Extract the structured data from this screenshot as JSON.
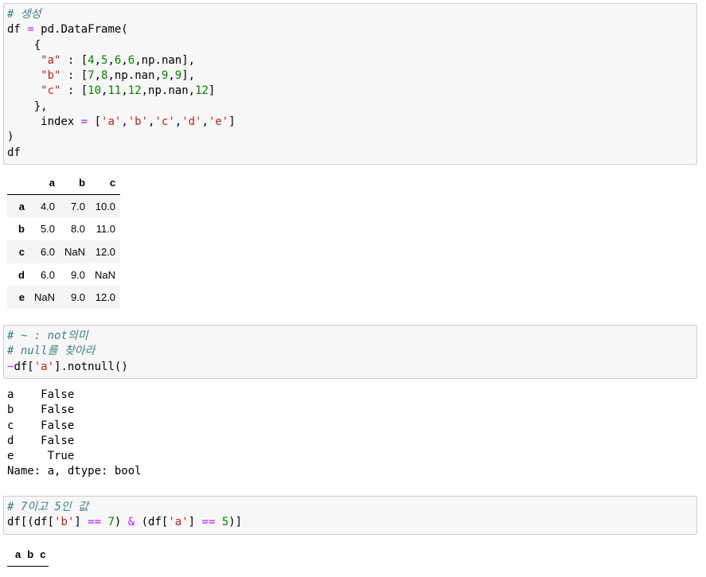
{
  "cell1": {
    "lines": [
      [
        {
          "t": "# 생성",
          "c": "cm"
        }
      ],
      [
        {
          "t": "df ",
          "c": ""
        },
        {
          "t": "=",
          "c": "o"
        },
        {
          "t": " pd.DataFrame(",
          "c": ""
        }
      ],
      [
        {
          "t": "    {",
          "c": ""
        }
      ],
      [
        {
          "t": "     ",
          "c": ""
        },
        {
          "t": "\"a\"",
          "c": "s"
        },
        {
          "t": " : [",
          "c": ""
        },
        {
          "t": "4",
          "c": "n"
        },
        {
          "t": ",",
          "c": ""
        },
        {
          "t": "5",
          "c": "n"
        },
        {
          "t": ",",
          "c": ""
        },
        {
          "t": "6",
          "c": "n"
        },
        {
          "t": ",",
          "c": ""
        },
        {
          "t": "6",
          "c": "n"
        },
        {
          "t": ",np.nan],",
          "c": ""
        }
      ],
      [
        {
          "t": "     ",
          "c": ""
        },
        {
          "t": "\"b\"",
          "c": "s"
        },
        {
          "t": " : [",
          "c": ""
        },
        {
          "t": "7",
          "c": "n"
        },
        {
          "t": ",",
          "c": ""
        },
        {
          "t": "8",
          "c": "n"
        },
        {
          "t": ",np.nan,",
          "c": ""
        },
        {
          "t": "9",
          "c": "n"
        },
        {
          "t": ",",
          "c": ""
        },
        {
          "t": "9",
          "c": "n"
        },
        {
          "t": "],",
          "c": ""
        }
      ],
      [
        {
          "t": "     ",
          "c": ""
        },
        {
          "t": "\"c\"",
          "c": "s"
        },
        {
          "t": " : [",
          "c": ""
        },
        {
          "t": "10",
          "c": "n"
        },
        {
          "t": ",",
          "c": ""
        },
        {
          "t": "11",
          "c": "n"
        },
        {
          "t": ",",
          "c": ""
        },
        {
          "t": "12",
          "c": "n"
        },
        {
          "t": ",np.nan,",
          "c": ""
        },
        {
          "t": "12",
          "c": "n"
        },
        {
          "t": "]",
          "c": ""
        }
      ],
      [
        {
          "t": "    },",
          "c": ""
        }
      ],
      [
        {
          "t": "     index ",
          "c": ""
        },
        {
          "t": "=",
          "c": "o"
        },
        {
          "t": " [",
          "c": ""
        },
        {
          "t": "'a'",
          "c": "s"
        },
        {
          "t": ",",
          "c": ""
        },
        {
          "t": "'b'",
          "c": "s"
        },
        {
          "t": ",",
          "c": ""
        },
        {
          "t": "'c'",
          "c": "s"
        },
        {
          "t": ",",
          "c": ""
        },
        {
          "t": "'d'",
          "c": "s"
        },
        {
          "t": ",",
          "c": ""
        },
        {
          "t": "'e'",
          "c": "s"
        },
        {
          "t": "]",
          "c": ""
        }
      ],
      [
        {
          "t": ")",
          "c": ""
        }
      ],
      [
        {
          "t": "df",
          "c": ""
        }
      ]
    ]
  },
  "table1": {
    "columns": [
      "a",
      "b",
      "c"
    ],
    "rows": [
      {
        "index": "a",
        "values": [
          "4.0",
          "7.0",
          "10.0"
        ]
      },
      {
        "index": "b",
        "values": [
          "5.0",
          "8.0",
          "11.0"
        ]
      },
      {
        "index": "c",
        "values": [
          "6.0",
          "NaN",
          "12.0"
        ]
      },
      {
        "index": "d",
        "values": [
          "6.0",
          "9.0",
          "NaN"
        ]
      },
      {
        "index": "e",
        "values": [
          "NaN",
          "9.0",
          "12.0"
        ]
      }
    ]
  },
  "cell2": {
    "lines": [
      [
        {
          "t": "# ~ : not의미",
          "c": "cm"
        }
      ],
      [
        {
          "t": "# null를 찾아라",
          "c": "cm"
        }
      ],
      [
        {
          "t": "~",
          "c": "o"
        },
        {
          "t": "df[",
          "c": ""
        },
        {
          "t": "'a'",
          "c": "s"
        },
        {
          "t": "].notnull()",
          "c": ""
        }
      ]
    ]
  },
  "output2": {
    "lines": [
      "a    False",
      "b    False",
      "c    False",
      "d    False",
      "e     True",
      "Name: a, dtype: bool"
    ]
  },
  "cell3": {
    "lines": [
      [
        {
          "t": "# 7이고 5인 값",
          "c": "cm"
        }
      ],
      [
        {
          "t": "df[(df[",
          "c": ""
        },
        {
          "t": "'b'",
          "c": "s"
        },
        {
          "t": "] ",
          "c": ""
        },
        {
          "t": "==",
          "c": "o"
        },
        {
          "t": " ",
          "c": ""
        },
        {
          "t": "7",
          "c": "n"
        },
        {
          "t": ") ",
          "c": ""
        },
        {
          "t": "&",
          "c": "o"
        },
        {
          "t": " (df[",
          "c": ""
        },
        {
          "t": "'a'",
          "c": "s"
        },
        {
          "t": "] ",
          "c": ""
        },
        {
          "t": "==",
          "c": "o"
        },
        {
          "t": " ",
          "c": ""
        },
        {
          "t": "5",
          "c": "n"
        },
        {
          "t": ")]",
          "c": ""
        }
      ]
    ]
  },
  "table3": {
    "columns": [
      "a",
      "b",
      "c"
    ]
  }
}
